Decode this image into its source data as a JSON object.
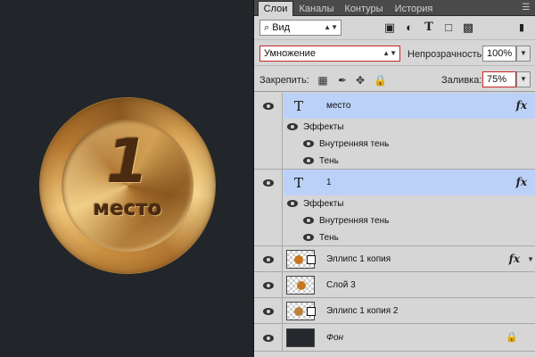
{
  "medal": {
    "number": "1",
    "caption": "место",
    "colors": {
      "gold": "#d6a552",
      "text": "#4a2a10"
    }
  },
  "panel": {
    "tabs": [
      {
        "label": "Слои",
        "active": true
      },
      {
        "label": "Каналы",
        "active": false
      },
      {
        "label": "Контуры",
        "active": false
      },
      {
        "label": "История",
        "active": false
      }
    ],
    "filter": {
      "kind_label": "⌕ Вид"
    },
    "blend": {
      "mode": "Умножение",
      "opacity_label": "Непрозрачность:",
      "opacity_value": "100%",
      "lock_label": "Закрепить:",
      "fill_label": "Заливка:",
      "fill_value": "75%"
    },
    "layers": [
      {
        "type": "text",
        "name": "место",
        "selected": true,
        "fx": "fx",
        "effects_label": "Эффекты",
        "effects": [
          "Внутренняя тень",
          "Тень"
        ]
      },
      {
        "type": "text",
        "name": "1",
        "selected": true,
        "fx": "fx",
        "effects_label": "Эффекты",
        "effects": [
          "Внутренняя тень",
          "Тень"
        ]
      },
      {
        "type": "shape",
        "name": "Эллипс 1 копия",
        "fx": "fx"
      },
      {
        "type": "pixel",
        "name": "Слой 3"
      },
      {
        "type": "shape",
        "name": "Эллипс 1 копия 2"
      },
      {
        "type": "background",
        "name": "Фон"
      }
    ],
    "accent_color": "#bcd1f7",
    "highlight_border": "#c62828"
  }
}
